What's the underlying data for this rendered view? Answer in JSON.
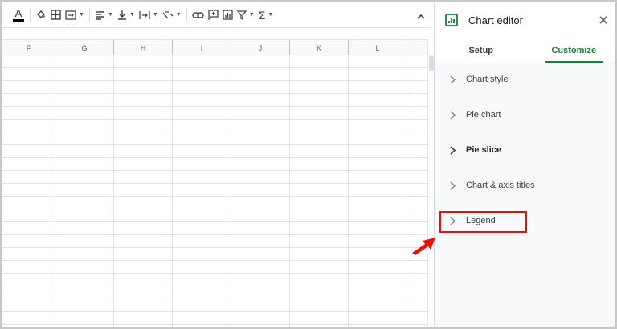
{
  "toolbar": {
    "items": [
      "text-color",
      "fill-color",
      "borders",
      "merge",
      "align",
      "valign",
      "wrap",
      "rotate",
      "link",
      "comment",
      "chart",
      "filter",
      "functions"
    ],
    "text_color_letter": "A"
  },
  "grid": {
    "columns": [
      "F",
      "G",
      "H",
      "I",
      "J",
      "K",
      "L"
    ]
  },
  "chart_editor": {
    "title": "Chart editor",
    "tabs": [
      {
        "label": "Setup",
        "active": false
      },
      {
        "label": "Customize",
        "active": true
      }
    ],
    "sections": [
      {
        "label": "Chart style",
        "bold": false
      },
      {
        "label": "Pie chart",
        "bold": false
      },
      {
        "label": "Pie slice",
        "bold": true
      },
      {
        "label": "Chart & axis titles",
        "bold": false
      },
      {
        "label": "Legend",
        "bold": false,
        "highlighted": true
      }
    ]
  },
  "colors": {
    "accent_green": "#188038",
    "highlight_red": "#e0120f"
  },
  "annotations": {
    "arrow": "red-arrow-pointing-to-legend"
  }
}
